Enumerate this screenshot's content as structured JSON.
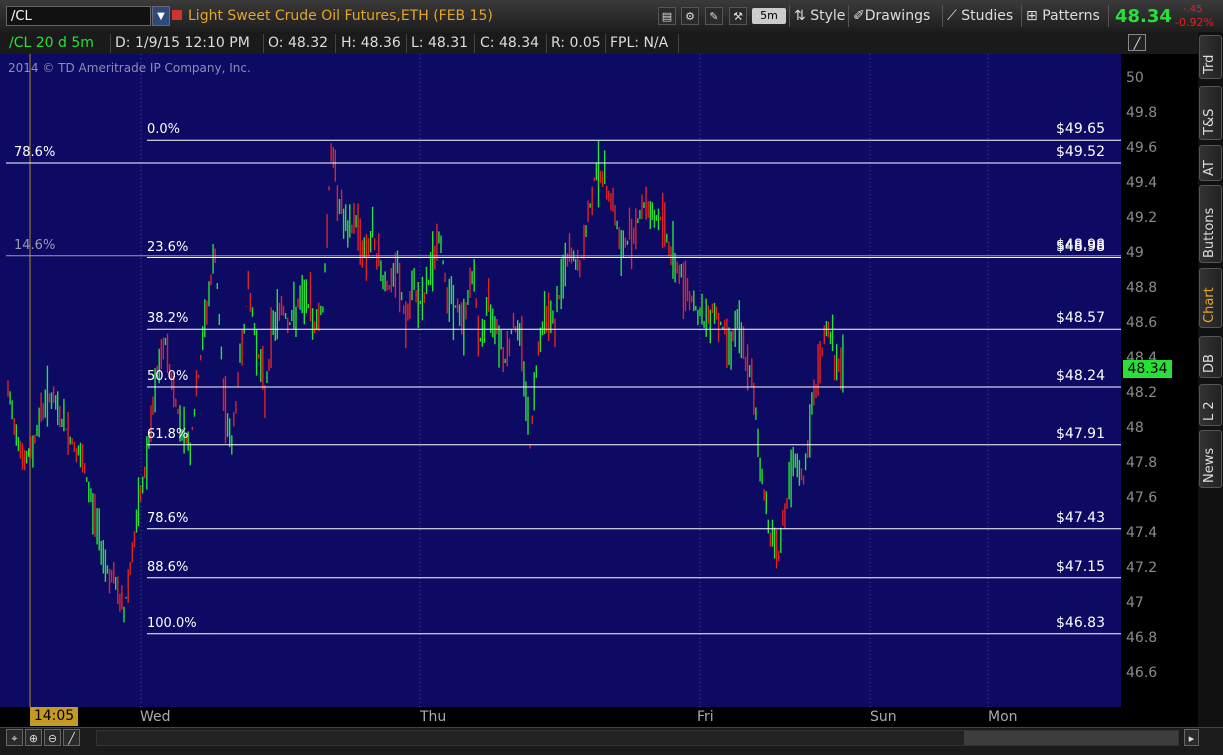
{
  "toolbar": {
    "symbol": "/CL",
    "title": "Light Sweet Crude Oil Futures,ETH (FEB 15)",
    "aggregation": "5m",
    "style_label": "Style",
    "drawings_label": "Drawings",
    "studies_label": "Studies",
    "patterns_label": "Patterns",
    "last_price": "48.34",
    "net_change": "-.45",
    "pct_change": "-0.92%"
  },
  "header": {
    "symbol_period": "/CL 20 d 5m",
    "date": "D: 1/9/15 12:10 PM",
    "open": "O: 48.32",
    "high": "H: 48.36",
    "low": "L: 48.31",
    "close": "C: 48.34",
    "range": "R: 0.05",
    "fpl": "FPL: N/A"
  },
  "copyright": "2014 © TD Ameritrade IP Company, Inc.",
  "side_tabs": [
    "Trd",
    "T&S",
    "AT",
    "Buttons",
    "Chart",
    "DB",
    "L 2",
    "News"
  ],
  "active_tab": "Chart",
  "cursor_time": "14:05",
  "price_badge": "48.34",
  "colors": {
    "plot_bg": "#0c0a62",
    "up": "#29e038",
    "down": "#e02424",
    "fib": "#ffffff",
    "accent": "#e3a52c"
  },
  "chart_data": {
    "type": "line",
    "ylim": [
      46.5,
      50.1
    ],
    "y_ticks": [
      "50",
      "49.8",
      "49.6",
      "49.4",
      "49.2",
      "49",
      "48.8",
      "48.6",
      "48.4",
      "48.2",
      "48",
      "47.8",
      "47.6",
      "47.4",
      "47.2",
      "47",
      "46.8",
      "46.6"
    ],
    "x_labels": [
      "Wed",
      "Thu",
      "Fri",
      "Sun",
      "Mon"
    ],
    "fib_levels": [
      {
        "pct": "0.0%",
        "price": "$49.65",
        "value": 49.65
      },
      {
        "pct": "23.6%",
        "price": "$48.98",
        "value": 48.98
      },
      {
        "pct": "38.2%",
        "price": "$48.57",
        "value": 48.57
      },
      {
        "pct": "50.0%",
        "price": "$48.24",
        "value": 48.24
      },
      {
        "pct": "61.8%",
        "price": "$47.91",
        "value": 47.91
      },
      {
        "pct": "78.6%",
        "price": "$47.43",
        "value": 47.43
      },
      {
        "pct": "88.6%",
        "price": "$47.15",
        "value": 47.15
      },
      {
        "pct": "100.0%",
        "price": "$46.83",
        "value": 46.83
      }
    ],
    "extra_levels": [
      {
        "pct": "78.6%",
        "price": "$49.52",
        "value": 49.52
      },
      {
        "pct": "14.6%",
        "price": "$48.98",
        "value": 48.99
      }
    ],
    "series": [
      {
        "values": [
          48.2,
          48.0,
          47.8,
          47.9,
          48.1,
          48.2,
          48.1,
          48.0,
          47.9,
          47.8,
          47.6,
          47.4,
          47.2,
          47.1,
          46.95,
          47.3,
          47.6,
          47.9,
          48.3,
          48.5,
          48.2,
          48.0,
          47.9,
          48.3,
          48.7,
          49.0,
          48.2,
          47.9,
          48.4,
          48.8,
          48.5,
          48.2,
          48.6,
          48.7,
          48.6,
          48.7,
          48.75,
          48.6,
          48.7,
          49.6,
          49.3,
          49.1,
          49.2,
          49.0,
          49.1,
          48.9,
          48.8,
          48.9,
          48.6,
          48.8,
          48.7,
          48.9,
          49.1,
          48.8,
          48.7,
          48.6,
          48.9,
          48.5,
          48.7,
          48.6,
          48.4,
          48.6,
          48.5,
          47.9,
          48.5,
          48.7,
          48.6,
          48.9,
          49.0,
          48.9,
          49.2,
          49.5,
          49.4,
          49.3,
          49.0,
          49.1,
          49.2,
          49.3,
          49.2,
          49.2,
          49.0,
          48.9,
          48.8,
          48.7,
          48.6,
          48.7,
          48.6,
          48.5,
          48.6,
          48.4,
          48.2,
          47.7,
          47.4,
          47.3,
          47.6,
          47.8,
          47.7,
          48.1,
          48.4,
          48.6,
          48.35,
          48.34
        ]
      }
    ]
  }
}
